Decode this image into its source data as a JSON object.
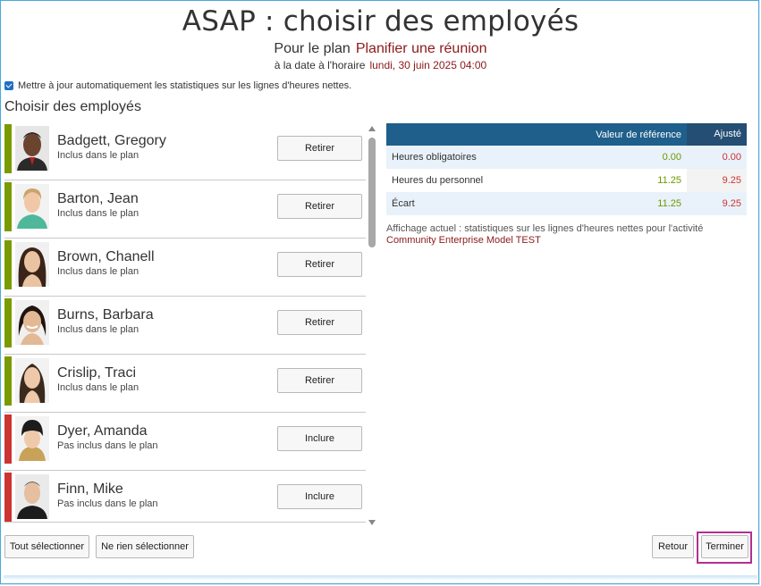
{
  "page": {
    "title": "ASAP : choisir des employés",
    "plan_prefix": "Pour le plan",
    "plan_name": "Planifier une réunion",
    "date_prefix": "à la date à l'horaire",
    "date_value": "lundi, 30 juin 2025 04:00"
  },
  "auto_update": {
    "checked": true,
    "label": "Mettre à jour automatiquement les statistiques sur les lignes d'heures nettes."
  },
  "section_title": "Choisir des employés",
  "employees": [
    {
      "name": "Badgett, Gregory",
      "status": "Inclus dans le plan",
      "included": true,
      "action": "Retirer"
    },
    {
      "name": "Barton, Jean",
      "status": "Inclus dans le plan",
      "included": true,
      "action": "Retirer"
    },
    {
      "name": "Brown, Chanell",
      "status": "Inclus dans le plan",
      "included": true,
      "action": "Retirer"
    },
    {
      "name": "Burns, Barbara",
      "status": "Inclus dans le plan",
      "included": true,
      "action": "Retirer"
    },
    {
      "name": "Crislip, Traci",
      "status": "Inclus dans le plan",
      "included": true,
      "action": "Retirer"
    },
    {
      "name": "Dyer, Amanda",
      "status": "Pas inclus dans le plan",
      "included": false,
      "action": "Inclure"
    },
    {
      "name": "Finn, Mike",
      "status": "Pas inclus dans le plan",
      "included": false,
      "action": "Inclure"
    }
  ],
  "stats": {
    "headers": {
      "label": "",
      "reference": "Valeur de référence",
      "adjusted": "Ajusté"
    },
    "rows": [
      {
        "label": "Heures obligatoires",
        "reference": "0.00",
        "adjusted": "0.00"
      },
      {
        "label": "Heures du personnel",
        "reference": "11.25",
        "adjusted": "9.25"
      },
      {
        "label": "Écart",
        "reference": "11.25",
        "adjusted": "9.25"
      }
    ],
    "note_prefix": "Affichage actuel : statistiques sur les lignes d'heures nettes pour l'activité",
    "note_activity": "Community Enterprise Model TEST"
  },
  "footer": {
    "select_all": "Tout sélectionner",
    "select_none": "Ne rien sélectionner",
    "back": "Retour",
    "finish": "Terminer"
  },
  "colors": {
    "included": "#7a9a01",
    "excluded": "#cc3333",
    "header": "#1f5f8b",
    "accent": "#8b1a1a",
    "highlight": "#b03090"
  }
}
